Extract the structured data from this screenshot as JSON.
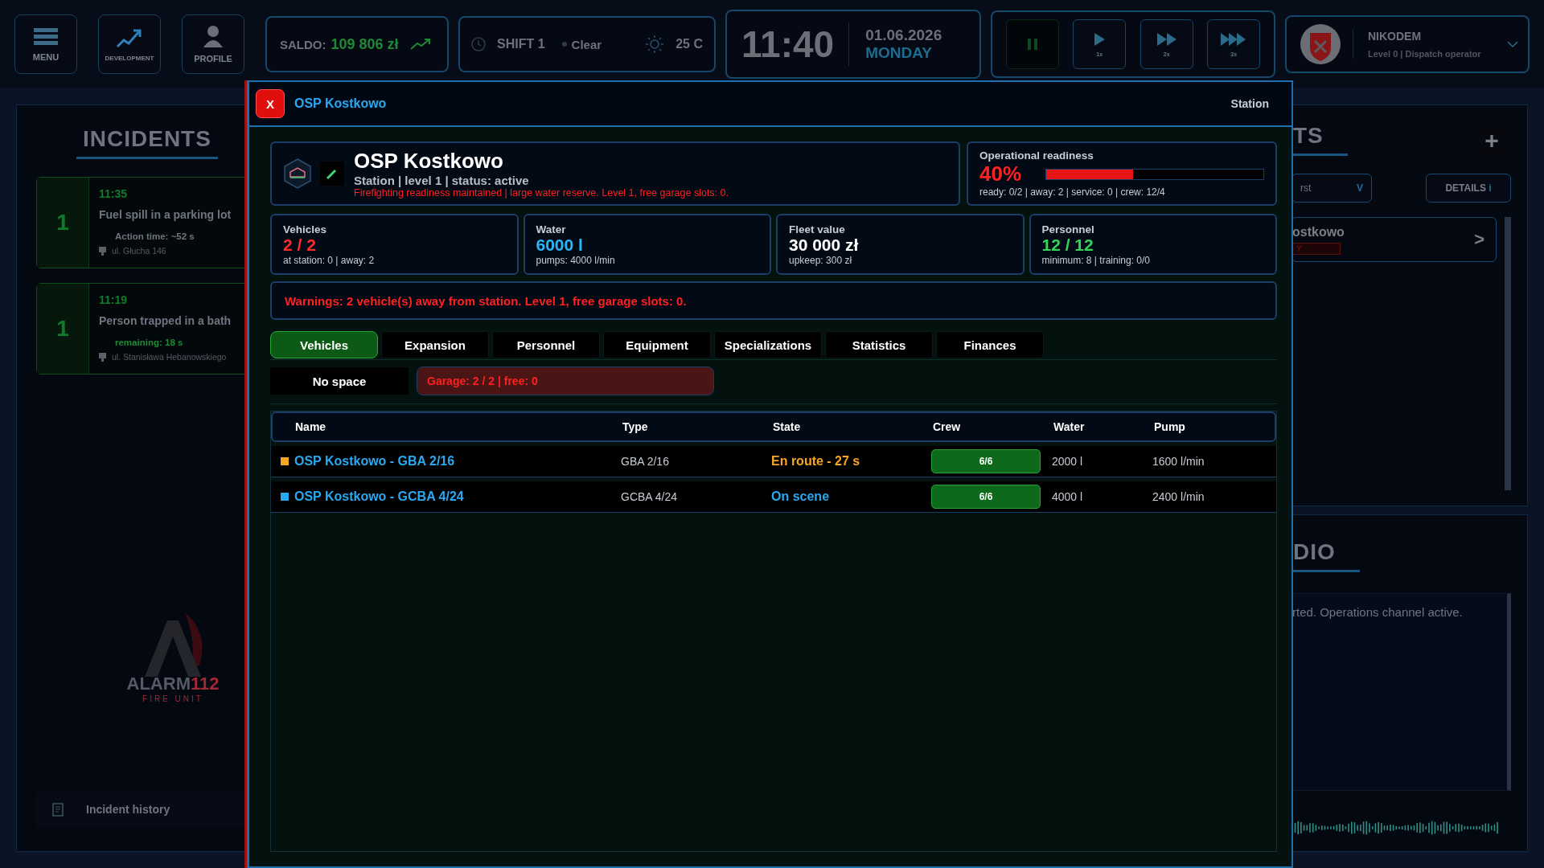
{
  "top_bar": {
    "nav_buttons": [
      {
        "label": "MENU",
        "kind": "menu"
      },
      {
        "label": "DEVELOPMENT",
        "kind": "development"
      },
      {
        "label": "PROFILE",
        "kind": "profile"
      }
    ],
    "balance": {
      "label": "SALDO:",
      "value": "109 806 zł"
    },
    "shift": "SHIFT 1",
    "weather": "Clear",
    "temperature": "25 C",
    "clock": {
      "time": "11:40",
      "date": "01.06.2026",
      "day": "MONDAY"
    },
    "speed_controls": [
      {
        "kind": "pause",
        "selected": true
      },
      {
        "label": "1x",
        "kind": "play1",
        "selected": false
      },
      {
        "label": "2x",
        "kind": "play2",
        "selected": false
      },
      {
        "label": "3x",
        "kind": "play3",
        "selected": false
      }
    ],
    "user": {
      "name": "NIKODEM",
      "role": "Level 0 | Dispatch operator"
    }
  },
  "incidents": {
    "title": "INCIDENTS",
    "items": [
      {
        "count": "1",
        "time": "11:35",
        "title": "Fuel spill in a parking lot",
        "info": "Action time: ~52 s",
        "kind": "action",
        "address": "ul. Głucha 146"
      },
      {
        "count": "1",
        "time": "11:19",
        "title": "Person trapped in a bath",
        "info": "remaining: 18 s",
        "kind": "remaining",
        "address": "ul. Stanisława Hebanowskiego"
      }
    ],
    "logo": {
      "name": "ALARM",
      "number": "112",
      "tagline": "FIRE UNIT"
    },
    "history": "Incident history"
  },
  "units": {
    "title": "TS",
    "add": "+",
    "sort": "rst",
    "sort_caret": "V",
    "details": "DETAILS",
    "details_icon": "i",
    "items": [
      {
        "name": "ostkowo",
        "badge": "Y",
        "arrow": ">"
      }
    ]
  },
  "radio": {
    "title": "DIO",
    "message": "rted. Operations channel active."
  },
  "modal": {
    "close": "X",
    "title": "OSP Kostkowo",
    "type": "Station",
    "station": {
      "name": "OSP Kostkowo",
      "subtitle": "Station | level 1 | status: active",
      "note": "Firefighting readiness maintained | large water reserve. Level 1, free garage slots: 0."
    },
    "readiness": {
      "label": "Operational readiness",
      "percent": "40%",
      "level": 0.4,
      "summary": "ready: 0/2 | away: 2 | service: 0 | crew: 12/4"
    },
    "stats": [
      {
        "label": "Vehicles",
        "value": "2 / 2",
        "sub": "at station: 0 | away: 2",
        "color": "#ff2a2a"
      },
      {
        "label": "Water",
        "value": "6000 l",
        "sub": "pumps: 4000 l/min",
        "color": "#29b6f6"
      },
      {
        "label": "Fleet value",
        "value": "30 000 zł",
        "sub": "upkeep: 300 zł",
        "color": "#ffffff"
      },
      {
        "label": "Personnel",
        "value": "12 / 12",
        "sub": "minimum: 8 | training: 0/0",
        "color": "#35d35a"
      }
    ],
    "warning": "Warnings: 2 vehicle(s) away from station. Level 1, free garage slots: 0.",
    "tabs": [
      {
        "label": "Vehicles",
        "selected": true
      },
      {
        "label": "Expansion",
        "selected": false
      },
      {
        "label": "Personnel",
        "selected": false
      },
      {
        "label": "Equipment",
        "selected": false
      },
      {
        "label": "Specializations",
        "selected": false
      },
      {
        "label": "Statistics",
        "selected": false
      },
      {
        "label": "Finances",
        "selected": false
      }
    ],
    "no_space": "No space",
    "garage": "Garage: 2 / 2 | free: 0",
    "table": {
      "columns": [
        "Name",
        "Type",
        "State",
        "Crew",
        "Water",
        "Pump"
      ],
      "rows": [
        {
          "color": "#f5a623",
          "name": "OSP Kostkowo - GBA 2/16",
          "type": "GBA 2/16",
          "state": "En route - 27 s",
          "kind": "en_route",
          "crew": "6/6",
          "water": "2000 l",
          "pump": "1600 l/min"
        },
        {
          "color": "#29a8f0",
          "name": "OSP Kostkowo - GCBA 4/24",
          "type": "GCBA 4/24",
          "state": "On scene",
          "kind": "on_scene",
          "crew": "6/6",
          "water": "4000 l",
          "pump": "2400 l/min"
        }
      ]
    }
  }
}
